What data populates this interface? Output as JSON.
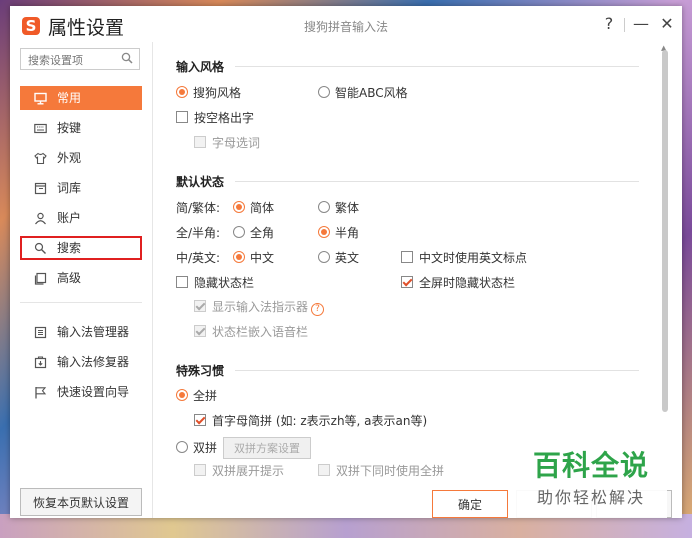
{
  "window": {
    "app_title": "属性设置",
    "logo_glyph": "S",
    "center_title": "搜狗拼音输入法",
    "help_label": "?",
    "minimize_label": "—",
    "close_label": "✕"
  },
  "sidebar": {
    "search_placeholder": "搜索设置项",
    "nav": [
      {
        "label": "常用",
        "icon": "monitor-icon"
      },
      {
        "label": "按键",
        "icon": "keyboard-icon"
      },
      {
        "label": "外观",
        "icon": "shirt-icon"
      },
      {
        "label": "词库",
        "icon": "book-icon"
      },
      {
        "label": "账户",
        "icon": "user-icon"
      },
      {
        "label": "搜索",
        "icon": "search-icon"
      },
      {
        "label": "高级",
        "icon": "layers-icon"
      }
    ],
    "tools": [
      {
        "label": "输入法管理器",
        "icon": "manager-icon"
      },
      {
        "label": "输入法修复器",
        "icon": "repair-icon"
      },
      {
        "label": "快速设置向导",
        "icon": "flag-icon"
      }
    ],
    "restore_label": "恢复本页默认设置"
  },
  "input_style": {
    "heading": "输入风格",
    "sogou_style": "搜狗风格",
    "abc_style": "智能ABC风格",
    "space_output": "按空格出字",
    "letter_select": "字母选词"
  },
  "default_state": {
    "heading": "默认状态",
    "trad_label": "简/繁体:",
    "simplified": "简体",
    "traditional": "繁体",
    "width_label": "全/半角:",
    "full_width": "全角",
    "half_width": "半角",
    "lang_label": "中/英文:",
    "chinese": "中文",
    "english": "英文",
    "en_punct": "中文时使用英文标点",
    "hide_status": "隐藏状态栏",
    "fullscreen_hide": "全屏时隐藏状态栏",
    "show_indicator": "显示输入法指示器",
    "embed_voice": "状态栏嵌入语音栏",
    "help_glyph": "?"
  },
  "habits": {
    "heading": "特殊习惯",
    "full_pinyin": "全拼",
    "initials": "首字母简拼 (如: z表示zh等, a表示an等)",
    "shuangpin": "双拼",
    "scheme_button": "双拼方案设置",
    "show_hint": "双拼展开提示",
    "use_both": "双拼下同时使用全拼"
  },
  "footer": {
    "ok_label": "确定"
  },
  "watermark": {
    "line1": "百科全说",
    "line2": "助你轻松解决"
  },
  "colors": {
    "accent": "#f5793b",
    "highlight_box": "#e02020",
    "watermark_green": "#2ea44a"
  }
}
